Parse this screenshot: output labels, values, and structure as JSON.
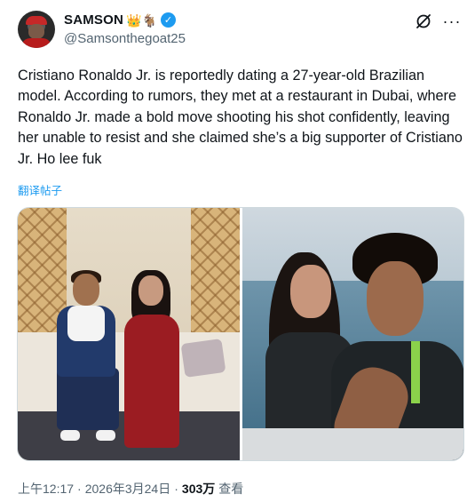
{
  "author": {
    "display_name": "SAMSON",
    "name_emojis": "👑🐐",
    "handle": "@Samsonthegoat25"
  },
  "tweet": {
    "text": "Cristiano Ronaldo Jr. is reportedly dating a 27-year-old Brazilian model. According to rumors, they met at a restaurant in Dubai, where Ronaldo Jr. made a bold move shooting his shot confidently, leaving her unable to resist and she claimed she’s a big supporter of Cristiano Jr. Ho lee fuk",
    "translate_label": "翻译帖子"
  },
  "meta": {
    "time": "上午12:17",
    "separator": "·",
    "date": "2026年3月24日",
    "views_count": "303万",
    "views_label": "查看"
  },
  "icons": {
    "verified": "verified-badge-icon",
    "grok": "grok-icon",
    "more": "more-options-icon"
  },
  "colors": {
    "accent": "#1d9bf0",
    "text_primary": "#0f1419",
    "text_secondary": "#536471"
  }
}
